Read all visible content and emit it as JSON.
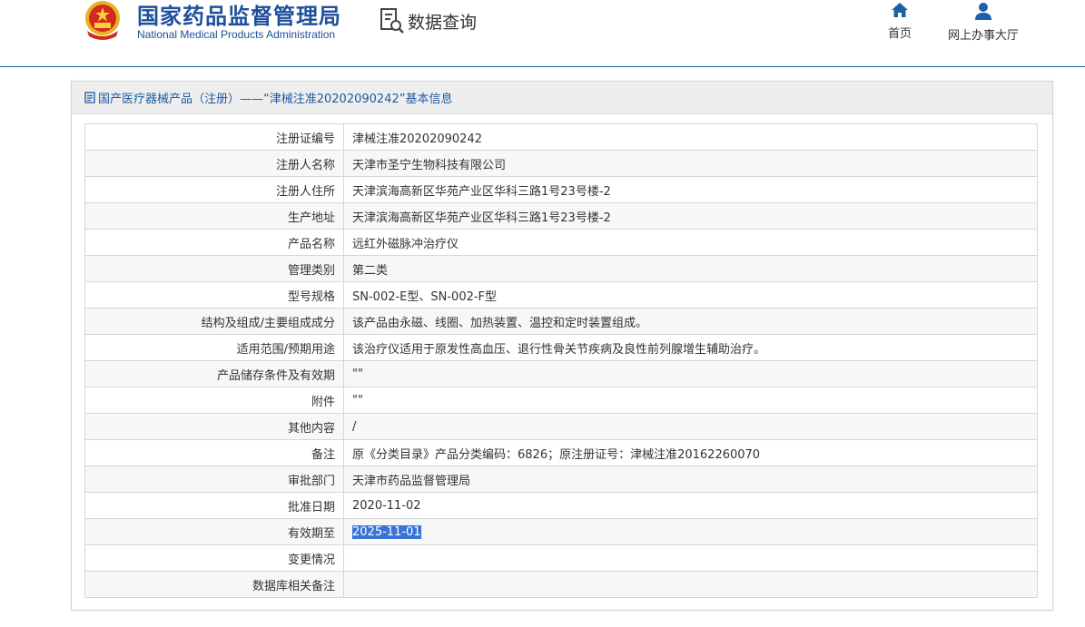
{
  "header": {
    "title_cn": "国家药品监督管理局",
    "title_en": "National Medical Products Administration",
    "data_query_label": "数据查询",
    "nav": [
      {
        "label": "首页",
        "icon": "home-icon"
      },
      {
        "label": "网上办事大厅",
        "icon": "user-icon"
      }
    ]
  },
  "panel": {
    "title": "国产医疗器械产品（注册）——“津械注准20202090242”基本信息",
    "icon": "document-icon"
  },
  "rows": [
    {
      "label": "注册证编号",
      "value": "津械注准20202090242"
    },
    {
      "label": "注册人名称",
      "value": "天津市圣宁生物科技有限公司"
    },
    {
      "label": "注册人住所",
      "value": "天津滨海高新区华苑产业区华科三路1号23号楼-2"
    },
    {
      "label": "生产地址",
      "value": "天津滨海高新区华苑产业区华科三路1号23号楼-2"
    },
    {
      "label": "产品名称",
      "value": "远红外磁脉冲治疗仪"
    },
    {
      "label": "管理类别",
      "value": "第二类"
    },
    {
      "label": "型号规格",
      "value": "SN-002-E型、SN-002-F型"
    },
    {
      "label": "结构及组成/主要组成成分",
      "value": "该产品由永磁、线圈、加热装置、温控和定时装置组成。"
    },
    {
      "label": "适用范围/预期用途",
      "value": "该治疗仪适用于原发性高血压、退行性骨关节疾病及良性前列腺增生辅助治疗。"
    },
    {
      "label": "产品储存条件及有效期",
      "value": "\"\""
    },
    {
      "label": "附件",
      "value": "\"\""
    },
    {
      "label": "其他内容",
      "value": "/"
    },
    {
      "label": "备注",
      "value": "原《分类目录》产品分类编码：6826；原注册证号：津械注准20162260070"
    },
    {
      "label": "审批部门",
      "value": "天津市药品监督管理局"
    },
    {
      "label": "批准日期",
      "value": "2020-11-02"
    },
    {
      "label": "有效期至",
      "value": "2025-11-01"
    },
    {
      "label": "变更情况",
      "value": ""
    },
    {
      "label": "数据库相关备注",
      "value": ""
    }
  ],
  "colors": {
    "brand_blue": "#1f4f9a",
    "link_blue": "#1e5aa3",
    "selection": "#3875d7"
  }
}
